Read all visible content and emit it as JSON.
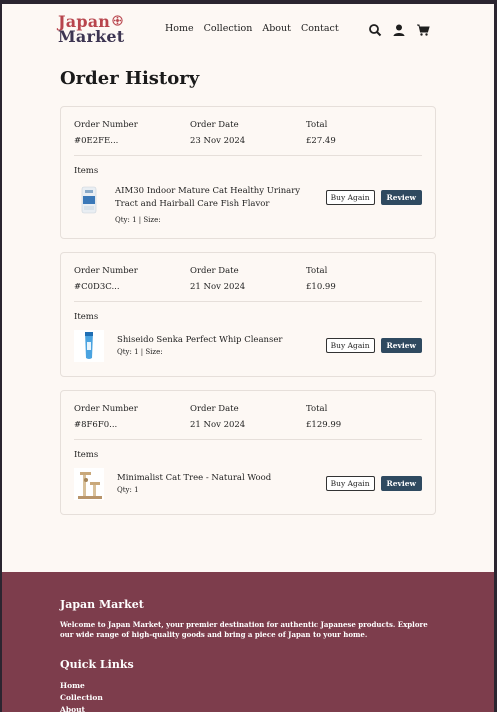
{
  "brand": {
    "line1": "Japan",
    "line2": "Market"
  },
  "nav": [
    "Home",
    "Collection",
    "About",
    "Contact"
  ],
  "page_title": "Order History",
  "labels": {
    "order_number": "Order Number",
    "order_date": "Order Date",
    "total": "Total",
    "items": "Items",
    "buy_again": "Buy Again",
    "review": "Review"
  },
  "orders": [
    {
      "number": "#0E2FE...",
      "date": "23 Nov 2024",
      "total": "£27.49",
      "item": {
        "name": "AIM30 Indoor Mature Cat Healthy Urinary Tract and Hairball Care Fish Flavor",
        "qty": "Qty: 1 | Size:"
      }
    },
    {
      "number": "#C0D3C...",
      "date": "21 Nov 2024",
      "total": "£10.99",
      "item": {
        "name": "Shiseido Senka Perfect Whip Cleanser",
        "qty": "Qty: 1 | Size:"
      }
    },
    {
      "number": "#8F6F0...",
      "date": "21 Nov 2024",
      "total": "£129.99",
      "item": {
        "name": "Minimalist Cat Tree - Natural Wood",
        "qty": "Qty: 1"
      }
    }
  ],
  "footer": {
    "brand": "Japan Market",
    "description": "Welcome to Japan Market, your premier destination for authentic Japanese products. Explore our wide range of high-quality goods and bring a piece of Japan to your home.",
    "quick_links_title": "Quick Links",
    "links": [
      "Home",
      "Collection",
      "About"
    ]
  },
  "colors": {
    "accent_red": "#b8454d",
    "accent_navy": "#3d3552",
    "button_dark": "#2f4a60",
    "footer_bg": "#7d3d4c"
  }
}
